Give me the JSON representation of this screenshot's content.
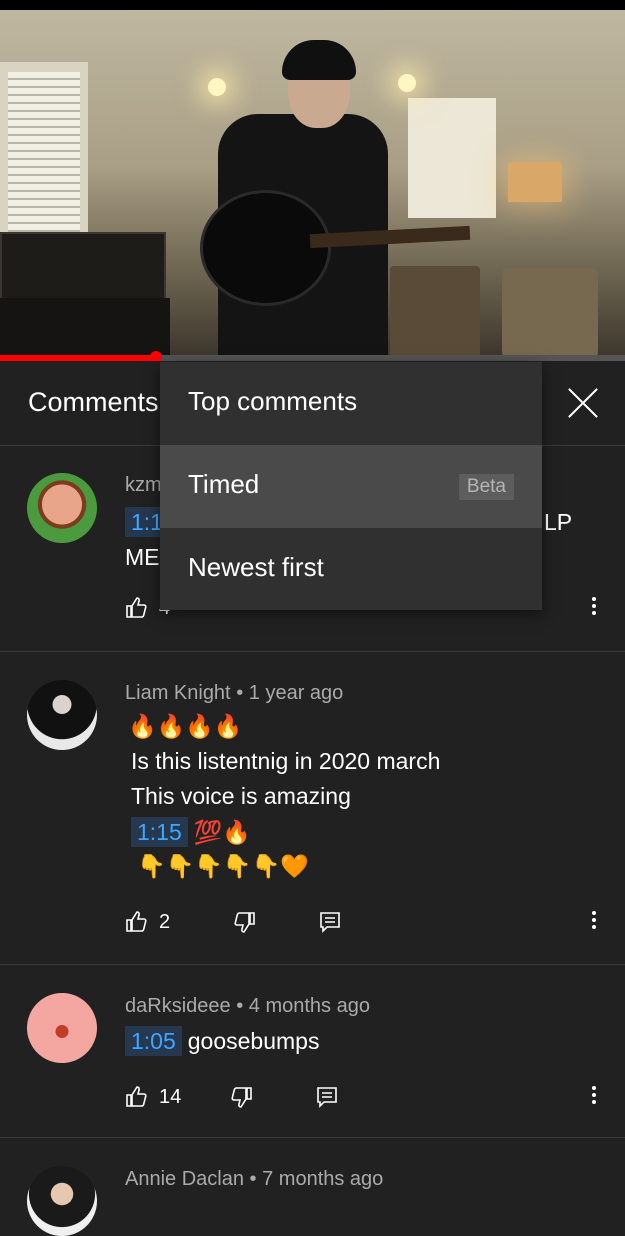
{
  "header": {
    "title": "Comments"
  },
  "sort_menu": {
    "items": [
      {
        "label": "Top comments"
      },
      {
        "label": "Timed",
        "badge": "Beta"
      },
      {
        "label": "Newest first"
      }
    ]
  },
  "comments": [
    {
      "author_partial": "kzm",
      "timestamp_partial": "1:1",
      "text_right_partial": "LP",
      "line2_partial": "ME",
      "likes_partial": "4"
    },
    {
      "author": "Liam Knight",
      "separator": "•",
      "age": "1 year ago",
      "line1": "🔥🔥🔥🔥",
      "line2": "Is this listentnig in 2020 march",
      "line3": "This voice is amazing",
      "timestamp": "1:15",
      "line4_suffix": "💯🔥",
      "line5": "👇👇👇👇👇🧡",
      "likes": "2"
    },
    {
      "author": "daRksideee",
      "separator": "•",
      "age": "4 months ago",
      "timestamp": "1:05",
      "text": "goosebumps",
      "likes": "14"
    },
    {
      "author": "Annie Daclan",
      "separator": "•",
      "age": "7 months ago"
    }
  ],
  "icons": [
    "like-icon",
    "dislike-icon",
    "reply-icon",
    "more-options-icon",
    "close-icon"
  ],
  "colors": {
    "background": "#212121",
    "menu": "#303030",
    "menu_selected": "#4a4a4a",
    "timestamp_text": "#3ea6ff",
    "timestamp_bg": "#263850",
    "progress": "#ff0000"
  },
  "video": {
    "progress_fraction": 0.25
  }
}
